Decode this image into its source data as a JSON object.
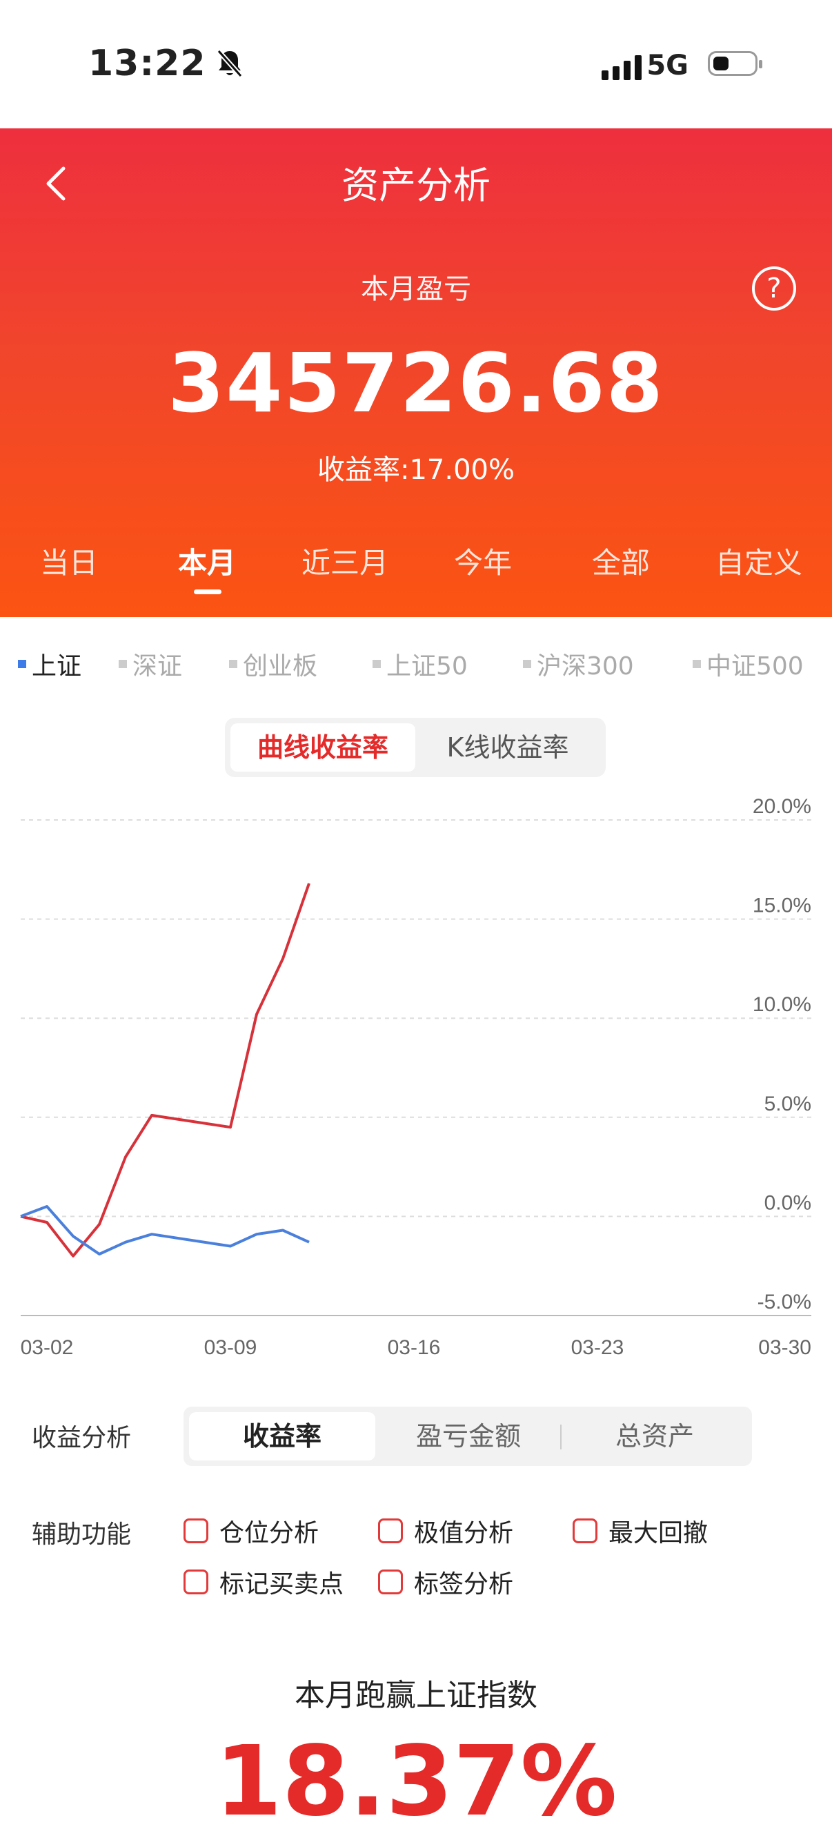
{
  "status_bar": {
    "time": "13:22",
    "network": "5G"
  },
  "header": {
    "title": "资产分析",
    "pl_label": "本月盈亏",
    "pl_value": "345726.68",
    "rate_text": "收益率:17.00%"
  },
  "periods": [
    "当日",
    "本月",
    "近三月",
    "今年",
    "全部",
    "自定义"
  ],
  "active_period": "本月",
  "indices": [
    "上证",
    "深证",
    "创业板",
    "上证50",
    "沪深300",
    "中证500"
  ],
  "active_index": "上证",
  "chart_mode": {
    "options": [
      "曲线收益率",
      "K线收益率"
    ],
    "active": "曲线收益率"
  },
  "chart_data": {
    "type": "line",
    "y_ticks": [
      "20.0%",
      "15.0%",
      "10.0%",
      "5.0%",
      "0.0%",
      "-5.0%"
    ],
    "x_ticks": [
      "03-02",
      "03-09",
      "03-16",
      "03-23",
      "03-30"
    ],
    "ylim": [
      -5,
      20
    ],
    "xlim": [
      "03-01",
      "03-30"
    ],
    "series": [
      {
        "color": "#d7313a",
        "points": [
          {
            "x": "03-01",
            "y": 0.0
          },
          {
            "x": "03-02",
            "y": -0.3
          },
          {
            "x": "03-03",
            "y": -2.0
          },
          {
            "x": "03-04",
            "y": -0.4
          },
          {
            "x": "03-05",
            "y": 3.0
          },
          {
            "x": "03-06",
            "y": 5.1
          },
          {
            "x": "03-09",
            "y": 4.5
          },
          {
            "x": "03-10",
            "y": 10.2
          },
          {
            "x": "03-11",
            "y": 13.0
          },
          {
            "x": "03-12",
            "y": 16.8
          }
        ]
      },
      {
        "color": "#4a80dc",
        "points": [
          {
            "x": "03-01",
            "y": 0.0
          },
          {
            "x": "03-02",
            "y": 0.5
          },
          {
            "x": "03-03",
            "y": -1.0
          },
          {
            "x": "03-04",
            "y": -1.9
          },
          {
            "x": "03-05",
            "y": -1.3
          },
          {
            "x": "03-06",
            "y": -0.9
          },
          {
            "x": "03-09",
            "y": -1.5
          },
          {
            "x": "03-10",
            "y": -0.9
          },
          {
            "x": "03-11",
            "y": -0.7
          },
          {
            "x": "03-12",
            "y": -1.3
          }
        ]
      }
    ]
  },
  "analysis": {
    "label": "收益分析",
    "options": [
      "收益率",
      "盈亏金额",
      "总资产"
    ],
    "active": "收益率"
  },
  "aux": {
    "label": "辅助功能",
    "items": [
      "仓位分析",
      "极值分析",
      "最大回撤",
      "标记买卖点",
      "标签分析"
    ]
  },
  "beat": {
    "title": "本月跑赢上证指数",
    "value": "18.37%"
  }
}
